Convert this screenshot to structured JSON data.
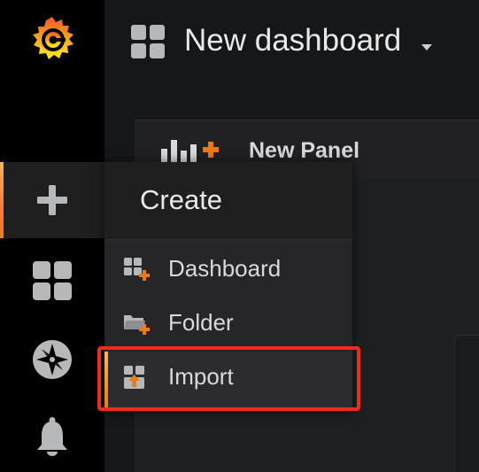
{
  "topbar": {
    "title": "New dashboard",
    "grid_icon": "dashboard-grid-icon",
    "caret_icon": "caret-down-icon"
  },
  "panel": {
    "header_label": "New Panel",
    "header_icon": "add-panel-icon"
  },
  "sidebar": {
    "logo": "grafana-logo",
    "items": [
      {
        "icon": "plus-icon",
        "name": "create",
        "active": true
      },
      {
        "icon": "dashboards-grid-icon",
        "name": "dashboards"
      },
      {
        "icon": "compass-icon",
        "name": "explore"
      },
      {
        "icon": "bell-icon",
        "name": "alerting"
      }
    ]
  },
  "create_menu": {
    "title": "Create",
    "items": [
      {
        "label": "Dashboard",
        "icon": "dashboard-add-icon"
      },
      {
        "label": "Folder",
        "icon": "folder-add-icon"
      },
      {
        "label": "Import",
        "icon": "import-icon",
        "active": true
      }
    ]
  },
  "colors": {
    "accent_orange": "#eb7b18",
    "highlight_red": "#ef2b1b",
    "sidebar_bg": "#000000",
    "page_bg": "#161719"
  }
}
